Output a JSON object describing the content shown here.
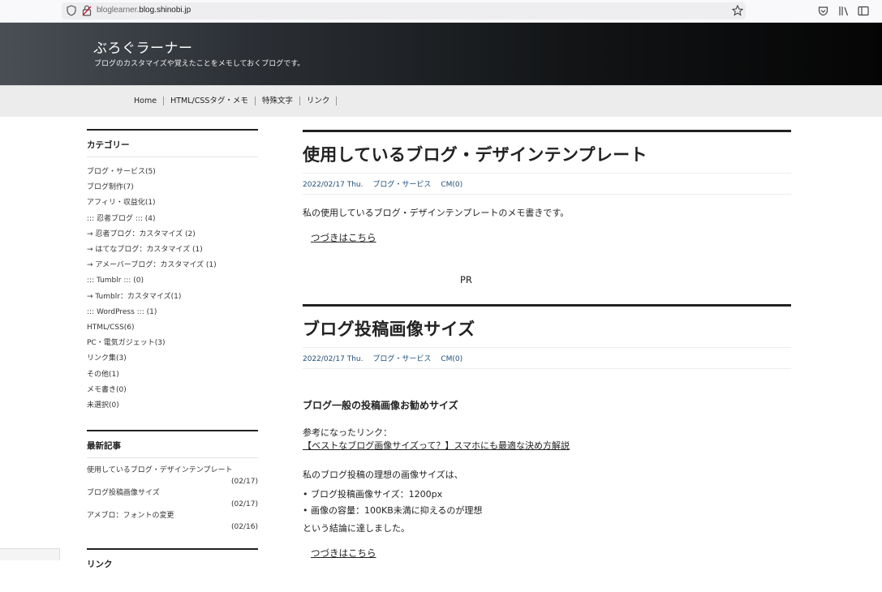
{
  "browser": {
    "url_prefix": "bloglearner.",
    "url_domain": "blog.shinobi.jp"
  },
  "site": {
    "title": "ぶろぐラーナー",
    "description": "ブログのカスタマイズや覚えたことをメモしておくブログです。"
  },
  "nav": {
    "items": [
      {
        "label": "Home"
      },
      {
        "label": "HTML/CSSタグ・メモ"
      },
      {
        "label": "特殊文字"
      },
      {
        "label": "リンク"
      }
    ]
  },
  "sidebar": {
    "categories_heading": "カテゴリー",
    "categories": [
      {
        "label": "ブログ・サービス(5)"
      },
      {
        "label": "ブログ制作(7)"
      },
      {
        "label": "アフィリ・収益化(1)"
      },
      {
        "label": "::: 忍者ブログ ::: (4)"
      },
      {
        "label": "→ 忍者ブログ：カスタマイズ (2)"
      },
      {
        "label": "→ はてなブログ：カスタマイズ (1)"
      },
      {
        "label": "→ アメーバーブログ：カスタマイズ (1)"
      },
      {
        "label": "::: Tumblr ::: (0)"
      },
      {
        "label": "→ Tumblr：カスタマイズ(1)"
      },
      {
        "label": "::: WordPress ::: (1)"
      },
      {
        "label": "HTML/CSS(6)"
      },
      {
        "label": "PC・電気ガジェット(3)"
      },
      {
        "label": "リンク集(3)"
      },
      {
        "label": "その他(1)"
      },
      {
        "label": "メモ書き(0)"
      },
      {
        "label": "未選択(0)"
      }
    ],
    "recent_heading": "最新記事",
    "recent": [
      {
        "title": "使用しているブログ・デザインテンプレート",
        "date": "(02/17)"
      },
      {
        "title": "ブログ投稿画像サイズ",
        "date": "(02/17)"
      },
      {
        "title": "アメブロ：フォントの変更",
        "date": "(02/16)"
      }
    ],
    "links_heading": "リンク"
  },
  "main": {
    "post1": {
      "title": "使用しているブログ・デザインテンプレート",
      "date": "2022/02/17 Thu.",
      "category": "ブログ・サービス",
      "comments": "CM(0)",
      "body": "私の使用しているブログ・デザインテンプレートのメモ書きです。",
      "more": "つづきはこちら"
    },
    "pr": "PR",
    "post2": {
      "title": "ブログ投稿画像サイズ",
      "date": "2022/02/17 Thu.",
      "category": "ブログ・サービス",
      "comments": "CM(0)",
      "heading": "ブログ一般の投稿画像お勧めサイズ",
      "ref_label": "参考になったリンク：",
      "ref_link": "【ベストなブログ画像サイズって？】スマホにも最適な決め方解説",
      "intro": "私のブログ投稿の理想の画像サイズは、",
      "bullets": [
        {
          "text": "ブログ投稿画像サイズ：1200px"
        },
        {
          "text": "画像の容量：100KB未満に抑えるのが理想"
        }
      ],
      "conclusion": "という結論に達しました。",
      "more": "つづきはこちら"
    }
  }
}
